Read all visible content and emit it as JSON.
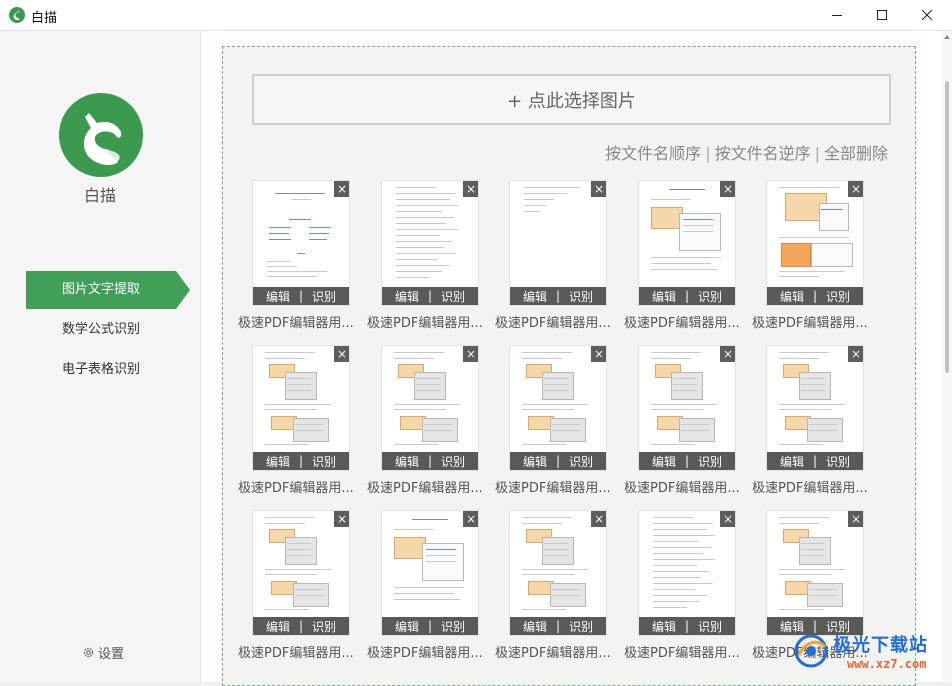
{
  "window": {
    "title": "白描"
  },
  "colors": {
    "accent": "#41a058",
    "logo_green": "#3b9a50"
  },
  "icons": {
    "app": "cat-logo-icon",
    "minimize": "minimize-icon",
    "maximize": "maximize-icon",
    "close": "close-icon",
    "settings": "gear-icon",
    "card_close": "close-icon"
  },
  "sidebar": {
    "app_name": "白描",
    "items": [
      {
        "label": "图片文字提取"
      },
      {
        "label": "数学公式识别"
      },
      {
        "label": "电子表格识别"
      }
    ],
    "active_index": 0,
    "settings_label": "设置"
  },
  "main": {
    "select_button": "+ 点此选择图片",
    "sort": {
      "by_name_asc": "按文件名顺序",
      "by_name_desc": "按文件名逆序",
      "delete_all": "全部删除",
      "separator": "|"
    },
    "card_close_glyph": "×",
    "edit_label": "编辑",
    "recognize_label": "识别",
    "action_separator": "|",
    "images": [
      {
        "name": "极速PDF编辑器用...",
        "thumb": "title-page"
      },
      {
        "name": "极速PDF编辑器用...",
        "thumb": "text-list"
      },
      {
        "name": "极速PDF编辑器用...",
        "thumb": "short-list"
      },
      {
        "name": "极速PDF编辑器用...",
        "thumb": "dialog"
      },
      {
        "name": "极速PDF编辑器用...",
        "thumb": "colorful"
      },
      {
        "name": "极速PDF编辑器用...",
        "thumb": "menus"
      },
      {
        "name": "极速PDF编辑器用...",
        "thumb": "menus"
      },
      {
        "name": "极速PDF编辑器用...",
        "thumb": "menus"
      },
      {
        "name": "极速PDF编辑器用...",
        "thumb": "menus"
      },
      {
        "name": "极速PDF编辑器用...",
        "thumb": "menus"
      },
      {
        "name": "极速PDF编辑器用...",
        "thumb": "menus"
      },
      {
        "name": "极速PDF编辑器用...",
        "thumb": "dialog"
      },
      {
        "name": "极速PDF编辑器用...",
        "thumb": "menus"
      },
      {
        "name": "极速PDF编辑器用...",
        "thumb": "text-list"
      },
      {
        "name": "极速PDF编辑器用...",
        "thumb": "menus"
      }
    ]
  },
  "watermark": {
    "title": "极光下载站",
    "url": "www.xz7.com"
  }
}
